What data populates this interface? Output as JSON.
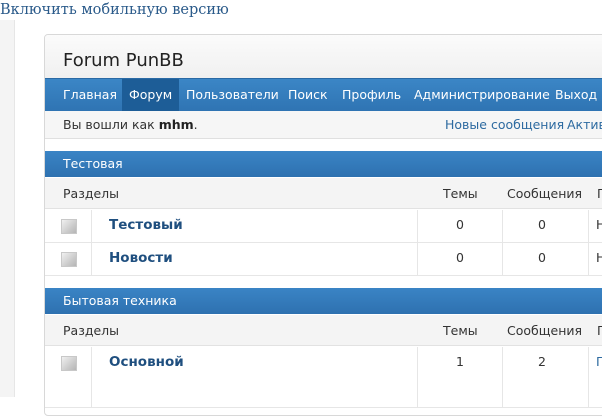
{
  "top_link": "Включить мобильную версию",
  "board_title": "Forum PunBB",
  "nav": [
    {
      "label": "Главная",
      "active": false
    },
    {
      "label": "Форум",
      "active": true
    },
    {
      "label": "Пользователи",
      "active": false
    },
    {
      "label": "Поиск",
      "active": false
    },
    {
      "label": "Профиль",
      "active": false
    },
    {
      "label": "Администрирование",
      "active": false
    },
    {
      "label": "Выход",
      "active": false
    }
  ],
  "status": {
    "logged_prefix": "Вы вошли как",
    "username": "mhm",
    "logged_suffix": ".",
    "new_posts": "Новые сообщения",
    "active_trunc": "Актив"
  },
  "columns": {
    "sections": "Разделы",
    "topics": "Темы",
    "posts": "Сообщения",
    "last_trunc": "П"
  },
  "categories": [
    {
      "title": "Тестовая",
      "forums": [
        {
          "name": "Тестовый",
          "topics": "0",
          "posts": "0",
          "last_trunc": "Н"
        },
        {
          "name": "Новости",
          "topics": "0",
          "posts": "0",
          "last_trunc": "Н"
        }
      ]
    },
    {
      "title": "Бытовая техника",
      "forums": [
        {
          "name": "Основной",
          "topics": "1",
          "posts": "2",
          "last_trunc": "П"
        }
      ]
    }
  ],
  "colors": {
    "nav_bg": "#2f74b3",
    "nav_active": "#1d5d97",
    "link": "#2d6aa0",
    "forum_name": "#1f4f7f"
  }
}
